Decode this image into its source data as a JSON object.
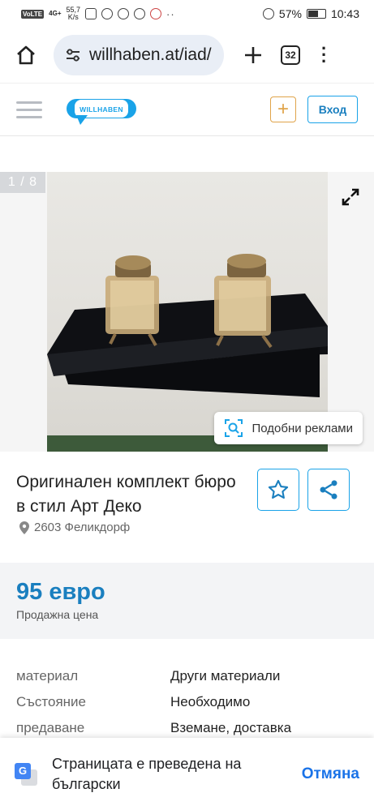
{
  "status_bar": {
    "volte": "VoLTE",
    "network": "4G+",
    "speed_value": "55,7",
    "speed_unit": "K/s",
    "battery": "57%",
    "time": "10:43"
  },
  "browser": {
    "url": "willhaben.at/iad/",
    "tab_count": "32"
  },
  "site_header": {
    "logo_text": "WILLHABEN",
    "post_icon": "+",
    "login_label": "Вход",
    "colors": {
      "brand": "#1aa3e8",
      "accent": "#e0a44a"
    }
  },
  "gallery": {
    "counter": "1 / 8",
    "similar_label": "Подобни реклами"
  },
  "listing": {
    "title": "Оригинален комплект бюро в стил Арт Деко",
    "location": "2603 Феликдорф",
    "price": "95 евро",
    "price_type": "Продажна цена",
    "attributes": [
      {
        "label": "материал",
        "value": "Други материали"
      },
      {
        "label": "Състояние",
        "value": "Необходимо"
      },
      {
        "label": "предаване",
        "value": "Вземане, доставка"
      }
    ]
  },
  "translate_bar": {
    "icon_letter": "G",
    "message": "Страницата е преведена на български",
    "undo_label": "Отмяна"
  }
}
